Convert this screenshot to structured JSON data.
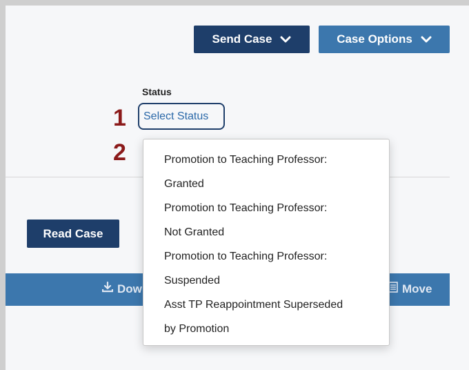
{
  "header": {
    "send_case_label": "Send Case",
    "case_options_label": "Case Options"
  },
  "status": {
    "label": "Status",
    "select_label": "Select Status"
  },
  "annotations": {
    "marker_1": "1",
    "marker_2": "2"
  },
  "actions": {
    "read_case_label": "Read Case"
  },
  "toolbar": {
    "download_label": "Dow",
    "move_label": "Move"
  },
  "dropdown": {
    "items": [
      {
        "line1": "Promotion to Teaching Professor:",
        "line2": "Granted"
      },
      {
        "line1": "Promotion to Teaching Professor:",
        "line2": "Not Granted"
      },
      {
        "line1": "Promotion to Teaching Professor:",
        "line2": "Suspended"
      },
      {
        "line1": "Asst TP Reappointment Superseded",
        "line2": "by Promotion"
      }
    ]
  },
  "colors": {
    "navy": "#1e3e6a",
    "blue": "#3c77ad",
    "link": "#2a68a8",
    "marker": "#8b1a1a"
  }
}
